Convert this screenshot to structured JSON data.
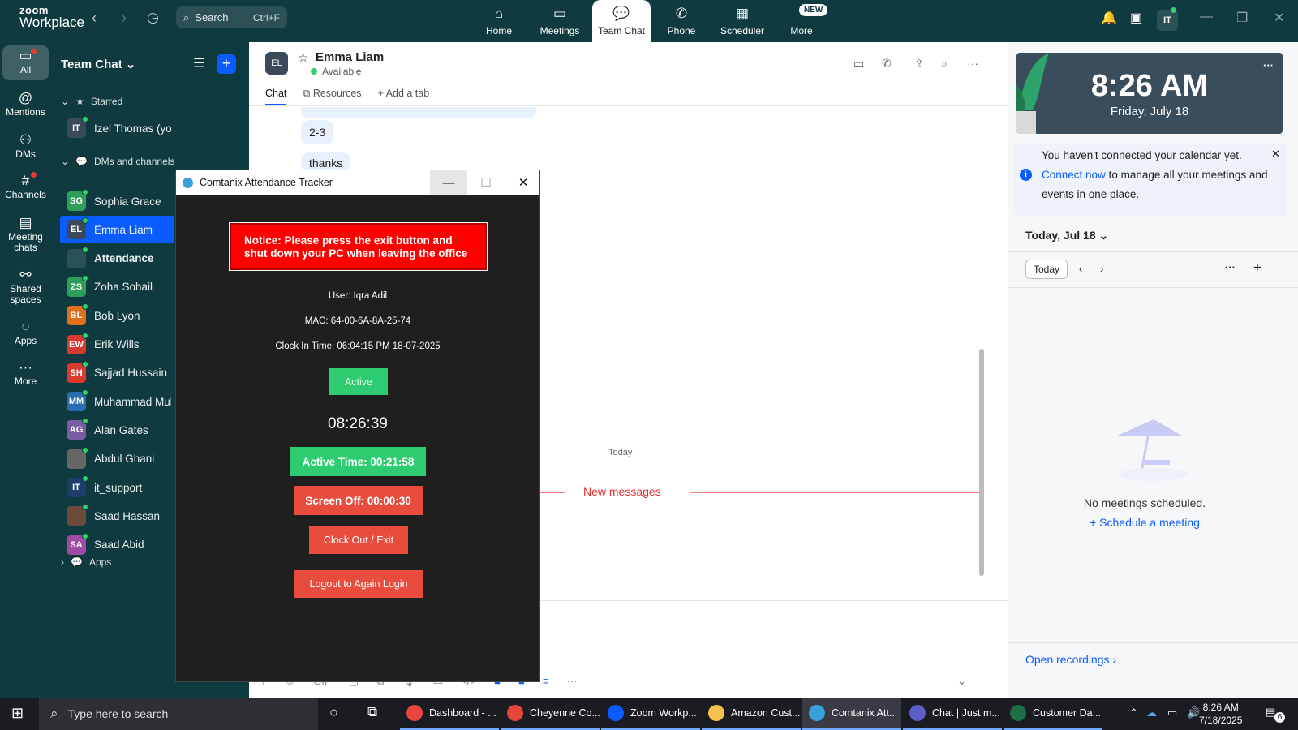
{
  "zoom": {
    "logo_line1": "zoom",
    "logo_line2": "Workplace",
    "search_placeholder": "Search",
    "search_shortcut": "Ctrl+F",
    "nav": [
      {
        "label": "Home",
        "icon": "home-icon"
      },
      {
        "label": "Meetings",
        "icon": "video-icon"
      },
      {
        "label": "Team Chat",
        "icon": "chat-icon"
      },
      {
        "label": "Phone",
        "icon": "phone-icon"
      },
      {
        "label": "Scheduler",
        "icon": "calendar-icon"
      },
      {
        "label": "More",
        "icon": "more-icon"
      }
    ],
    "new_badge": "NEW",
    "user_initials": "IT"
  },
  "rail": [
    {
      "label": "All",
      "icon": "chat-bubble-icon"
    },
    {
      "label": "Mentions",
      "icon": "at-icon"
    },
    {
      "label": "DMs",
      "icon": "people-icon"
    },
    {
      "label": "Channels",
      "icon": "hash-icon"
    },
    {
      "label": "Meeting chats",
      "icon": "meeting-chat-icon"
    },
    {
      "label": "Shared spaces",
      "icon": "shared-icon"
    },
    {
      "label": "Apps",
      "icon": "apps-icon"
    },
    {
      "label": "More",
      "icon": "more-icon"
    }
  ],
  "channels": {
    "title": "Team Chat",
    "starred_label": "Starred",
    "dms_label": "DMs and channels",
    "apps_label": "Apps",
    "starred": [
      {
        "initials": "IT",
        "name": "Izel Thomas (you)",
        "color": "#3b4a5a"
      }
    ],
    "items": [
      {
        "initials": "SG",
        "name": "Sophia Grace",
        "color": "#2e9e5b"
      },
      {
        "initials": "EL",
        "name": "Emma Liam",
        "color": "#3b4a5a"
      },
      {
        "initials": "",
        "name": "Attendance",
        "color": "#2b5157"
      },
      {
        "initials": "ZS",
        "name": "Zoha Sohail",
        "color": "#2e9e5b"
      },
      {
        "initials": "BL",
        "name": "Bob Lyon",
        "color": "#e0701b"
      },
      {
        "initials": "EW",
        "name": "Erik Wills",
        "color": "#d9392f"
      },
      {
        "initials": "SH",
        "name": "Sajjad Hussain",
        "color": "#d9392f"
      },
      {
        "initials": "MM",
        "name": "Muhammad Muhammad",
        "color": "#2b6cb0"
      },
      {
        "initials": "AG",
        "name": "Alan Gates",
        "color": "#7a5ca6"
      },
      {
        "initials": "",
        "name": "Abdul Ghani",
        "color": "#666666"
      },
      {
        "initials": "IT",
        "name": "it_support",
        "color": "#1f3d6b"
      },
      {
        "initials": "",
        "name": "Saad Hassan",
        "color": "#6b4a3a"
      },
      {
        "initials": "SA",
        "name": "Saad Abid",
        "color": "#a04aa6"
      }
    ]
  },
  "chat": {
    "initials": "EL",
    "name": "Emma Liam",
    "status": "Available",
    "tabs": [
      "Chat",
      "Resources",
      "Add a tab"
    ],
    "messages": [
      "2-3",
      "thanks"
    ],
    "date_label": "Today",
    "new_messages": "New messages"
  },
  "right_panel": {
    "time": "8:26 AM",
    "date": "Friday, July 18",
    "notice_pre": "You haven't connected your calendar yet.",
    "notice_link": "Connect now",
    "notice_post": "to manage all your meetings and events in one place.",
    "today_header": "Today, Jul 18",
    "today_button": "Today",
    "no_meetings": "No meetings scheduled.",
    "schedule_link": "Schedule a meeting",
    "open_recordings": "Open recordings"
  },
  "tracker": {
    "title": "Comtanix Attendance Tracker",
    "notice": "Notice: Please press the exit button and shut down your PC when leaving the office",
    "user": "User: Iqra Adil",
    "mac": "MAC: 64-00-6A-8A-25-74",
    "clock_in": "Clock In Time: 06:04:15 PM 18-07-2025",
    "status": "Active",
    "timer": "08:26:39",
    "active_time": "Active Time: 00:21:58",
    "screen_off": "Screen Off: 00:00:30",
    "clock_out": "Clock Out / Exit",
    "logout": "Logout to Again Login"
  },
  "taskbar": {
    "search_placeholder": "Type here to search",
    "apps": [
      {
        "label": "Dashboard - ...",
        "color": "#e8453c"
      },
      {
        "label": "Cheyenne Co...",
        "color": "#e8453c"
      },
      {
        "label": "Zoom Workp...",
        "color": "#0b5cff"
      },
      {
        "label": "Amazon Cust...",
        "color": "#f2c14e"
      },
      {
        "label": "Comtanix Att...",
        "color": "#3aa0d8"
      },
      {
        "label": "Chat | Just m...",
        "color": "#5b5fc7"
      },
      {
        "label": "Customer Da...",
        "color": "#1d7044"
      }
    ],
    "time": "8:26 AM",
    "date": "7/18/2025",
    "notif_count": "6"
  }
}
